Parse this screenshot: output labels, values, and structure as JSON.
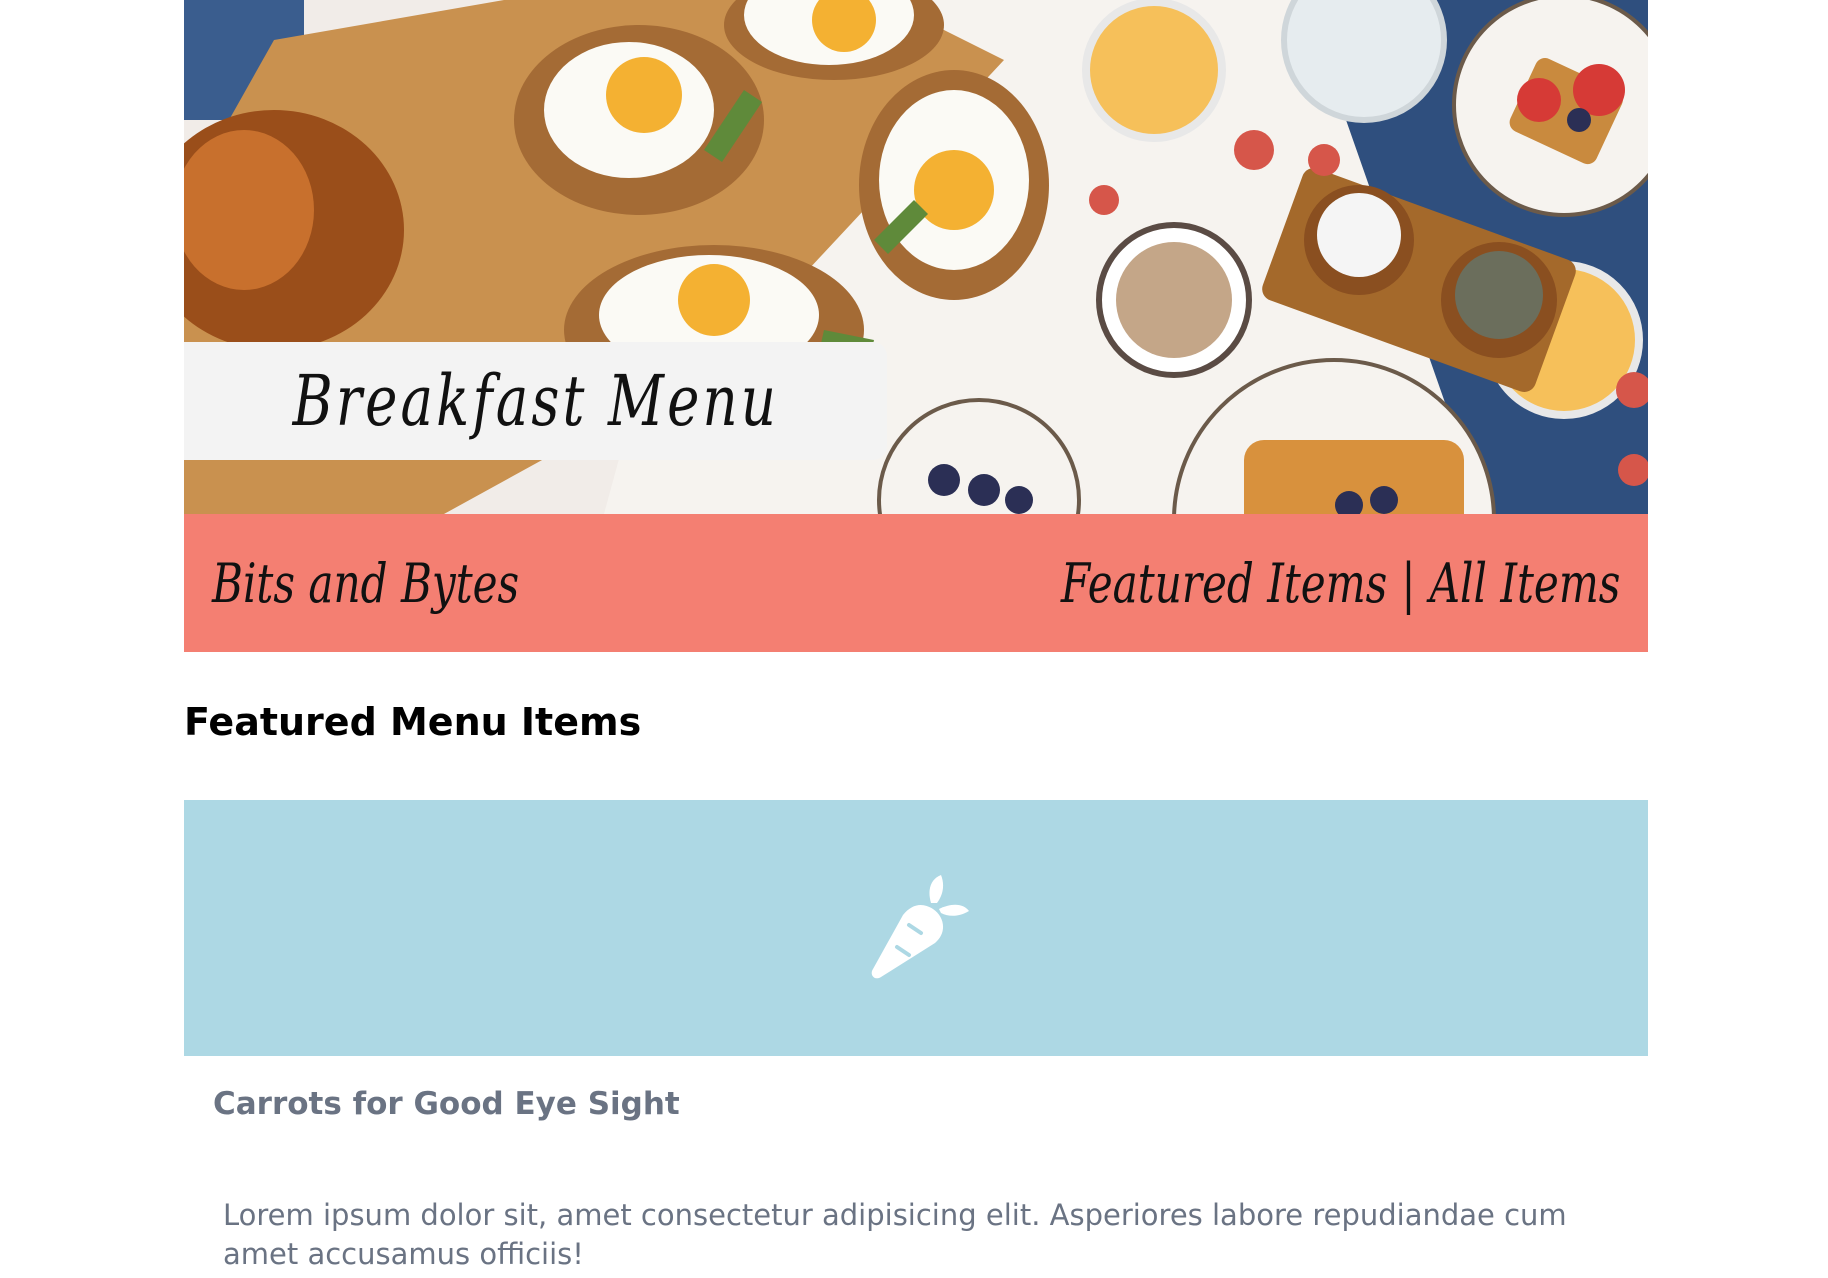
{
  "hero": {
    "title": "Breakfast Menu",
    "image_icon": "breakfast-photo"
  },
  "navbar": {
    "brand": "Bits and Bytes",
    "links": [
      "Featured Items",
      "All Items"
    ],
    "separator": "|",
    "background_color": "#f47f72"
  },
  "main": {
    "section_title": "Featured Menu Items",
    "featured": [
      {
        "icon": "carrot-icon",
        "image_background": "#add8e4",
        "title": "Carrots for Good Eye Sight",
        "description": "Lorem ipsum dolor sit, amet consectetur adipisicing elit. Asperiores labore repudiandae cum amet accusamus officiis!"
      }
    ]
  }
}
